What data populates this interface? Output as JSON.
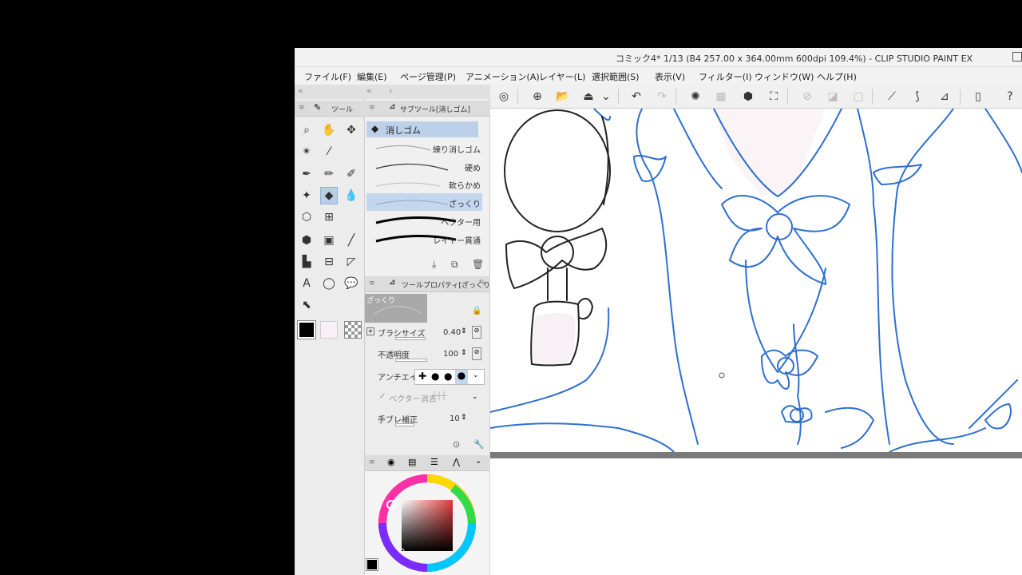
{
  "window": {
    "title": "コミック4* 1/13 (B4 257.00 x 364.00mm 600dpi 109.4%) - CLIP STUDIO PAINT EX"
  },
  "menu": [
    {
      "label": "ファイル(F)"
    },
    {
      "label": "編集(E)"
    },
    {
      "label": "ページ管理(P)"
    },
    {
      "label": "アニメーション(A)"
    },
    {
      "label": "レイヤー(L)"
    },
    {
      "label": "選択範囲(S)"
    },
    {
      "label": "表示(V)"
    },
    {
      "label": "フィルター(I)"
    },
    {
      "label": "ウィンドウ(W)"
    },
    {
      "label": "ヘルプ(H)"
    }
  ],
  "tool_panel": {
    "tab_label": "ツール"
  },
  "subtool_panel": {
    "tab_label": "サブツール[消しゴム]",
    "group_label": "消しゴム",
    "brushes": [
      {
        "label": "練り消しゴム"
      },
      {
        "label": "硬め"
      },
      {
        "label": "軟らかめ"
      },
      {
        "label": "ざっくり",
        "selected": true
      },
      {
        "label": "ベクター用"
      },
      {
        "label": "レイヤー貫通"
      }
    ]
  },
  "tool_property": {
    "tab_label": "ツールプロパティ[ざっくり]",
    "preview_label": "ざっくり",
    "brush_size": {
      "label": "ブラシサイズ",
      "value": "0.40"
    },
    "opacity": {
      "label": "不透明度",
      "value": "100"
    },
    "antialias": {
      "label": "アンチエイリアス"
    },
    "vector_erase": {
      "label": "ベクター消去"
    },
    "stabilization": {
      "label": "手ブレ補正",
      "value": "10"
    }
  },
  "colors": {
    "main": "#000000",
    "sub": "#f7f0f4",
    "accent": "#c3d6ee",
    "line_blue": "#2f6fd0"
  }
}
